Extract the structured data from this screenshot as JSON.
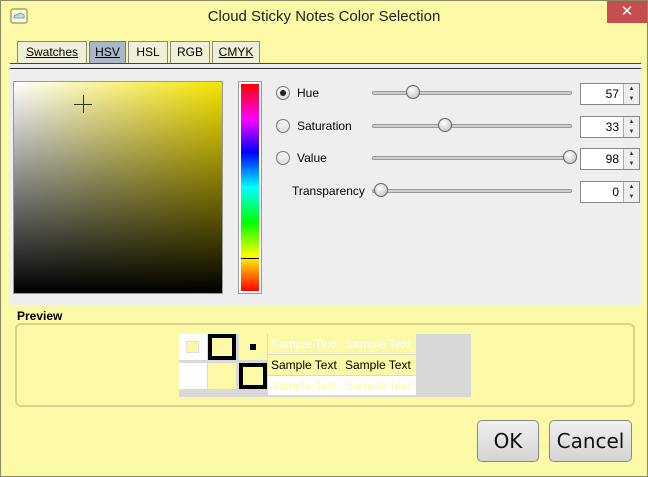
{
  "window": {
    "title": "Cloud Sticky Notes Color Selection",
    "close_symbol": "✕",
    "app_icon": "cloud-note-icon"
  },
  "tabs": [
    {
      "label": "Swatches",
      "active": false
    },
    {
      "label": "HSV",
      "active": true
    },
    {
      "label": "HSL",
      "active": false
    },
    {
      "label": "RGB",
      "active": false
    },
    {
      "label": "CMYK",
      "active": false
    }
  ],
  "hsv": {
    "hue": {
      "label": "Hue",
      "value": "57",
      "selected": true
    },
    "saturation": {
      "label": "Saturation",
      "value": "33",
      "selected": false
    },
    "value": {
      "label": "Value",
      "value": "98",
      "selected": false
    },
    "transparency": {
      "label": "Transparency",
      "value": "0"
    }
  },
  "preview": {
    "label": "Preview",
    "sample_text": "Sample Text"
  },
  "buttons": {
    "ok": "OK",
    "cancel": "Cancel"
  },
  "colors": {
    "background": "#fbf8a6",
    "selected_color": "#fbf8a6",
    "close_button": "#c74e4e",
    "active_tab": "#aab7c8"
  }
}
